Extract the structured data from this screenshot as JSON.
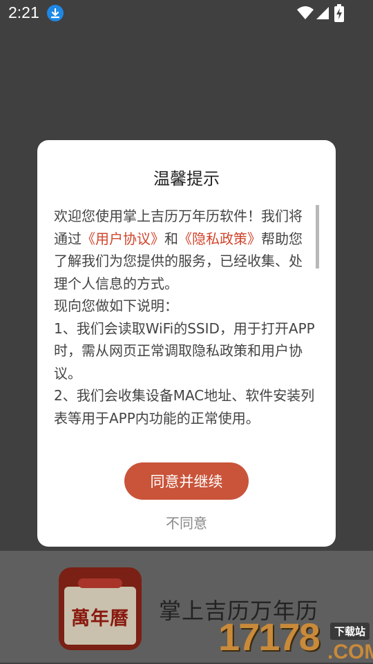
{
  "status_bar": {
    "time": "2:21",
    "icons": [
      "download-notification-icon",
      "wifi-icon",
      "signal-icon",
      "battery-charging-icon"
    ]
  },
  "dialog": {
    "title": "温馨提示",
    "intro_before": "欢迎您使用掌上吉历万年历软件！我们将通过",
    "user_agreement_link": "《用户协议》",
    "intro_and": "和",
    "privacy_policy_link": "《隐私政策》",
    "intro_after": "帮助您了解我们为您提供的服务，已经收集、处理个人信息的方式。",
    "line_notice": "现向您做如下说明：",
    "item_1": "1、我们会读取WiFi的SSID，用于打开APP时，需从网页正常调取隐私政策和用户协议。",
    "item_2": "2、我们会收集设备MAC地址、软件安装列表等用于APP内功能的正常使用。",
    "agree_button": "同意并继续",
    "disagree_button": "不同意"
  },
  "splash": {
    "logo_text": "萬年曆",
    "app_name": "掌上吉历万年历"
  },
  "watermark": {
    "number": "17178",
    "domain": ".COM",
    "tag": "下载站"
  },
  "colors": {
    "accent": "#c9543a",
    "link": "#d0452c",
    "overlay": "#404040"
  }
}
